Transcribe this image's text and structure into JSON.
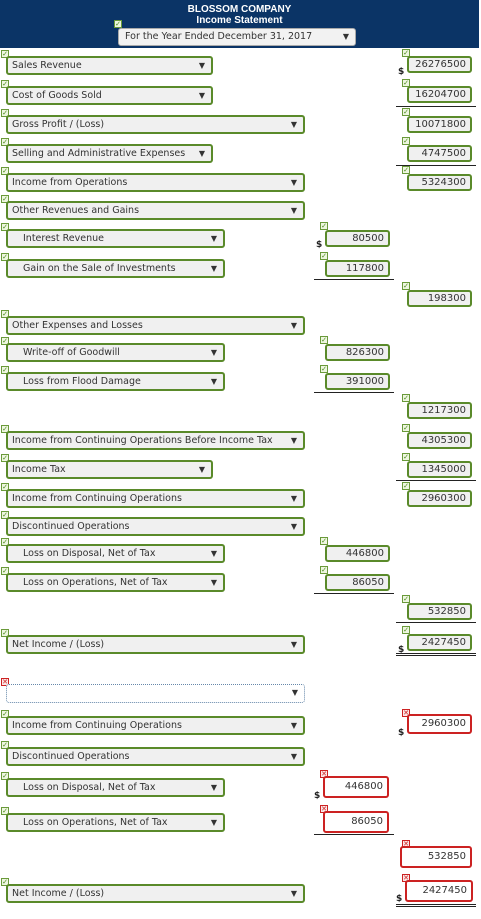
{
  "header": {
    "company": "BLOSSOM COMPANY",
    "statement": "Income Statement",
    "period": "For the Year Ended December 31, 2017"
  },
  "icons": {
    "check": "✓",
    "cross": "✕",
    "arrow": "▼"
  },
  "colors": {
    "header_bg": "#0b3466",
    "correct": "#5a8a2a",
    "incorrect": "#cc2222"
  },
  "rows": {
    "sales_revenue": {
      "label": "Sales Revenue",
      "value": "26276500"
    },
    "cogs": {
      "label": "Cost of Goods Sold",
      "value": "16204700"
    },
    "gross_profit": {
      "label": "Gross Profit / (Loss)",
      "value": "10071800"
    },
    "selling_admin": {
      "label": "Selling and Administrative Expenses",
      "value": "4747500"
    },
    "income_ops": {
      "label": "Income from Operations",
      "value": "5324300"
    },
    "other_rev": {
      "label": "Other Revenues and Gains"
    },
    "interest_rev": {
      "label": "Interest Revenue",
      "value": "80500"
    },
    "gain_sale": {
      "label": "Gain on the Sale of Investments",
      "value": "117800"
    },
    "other_rev_total": {
      "value": "198300"
    },
    "other_exp": {
      "label": "Other Expenses and Losses"
    },
    "writeoff": {
      "label": "Write-off of Goodwill",
      "value": "826300"
    },
    "loss_flood": {
      "label": "Loss from Flood Damage",
      "value": "391000"
    },
    "other_exp_total": {
      "value": "1217300"
    },
    "income_before_tax": {
      "label": "Income from Continuing Operations Before Income Tax",
      "value": "4305300"
    },
    "income_tax": {
      "label": "Income Tax",
      "value": "1345000"
    },
    "income_cont": {
      "label": "Income from Continuing Operations",
      "value": "2960300"
    },
    "discontinued": {
      "label": "Discontinued Operations"
    },
    "loss_disposal": {
      "label": "Loss on Disposal, Net of Tax",
      "value": "446800"
    },
    "loss_operations": {
      "label": "Loss on Operations, Net of Tax",
      "value": "86050"
    },
    "disc_total": {
      "value": "532850"
    },
    "net_income": {
      "label": "Net Income / (Loss)",
      "value": "2427450"
    }
  },
  "second": {
    "blank_select": "",
    "income_cont": {
      "label": "Income from Continuing Operations",
      "value": "2960300"
    },
    "discontinued": {
      "label": "Discontinued Operations"
    },
    "loss_disposal": {
      "label": "Loss on Disposal, Net of Tax",
      "value": "446800"
    },
    "loss_operations": {
      "label": "Loss on Operations, Net of Tax",
      "value": "86050"
    },
    "disc_total": {
      "value": "532850"
    },
    "net_income": {
      "label": "Net Income / (Loss)",
      "value": "2427450"
    }
  }
}
